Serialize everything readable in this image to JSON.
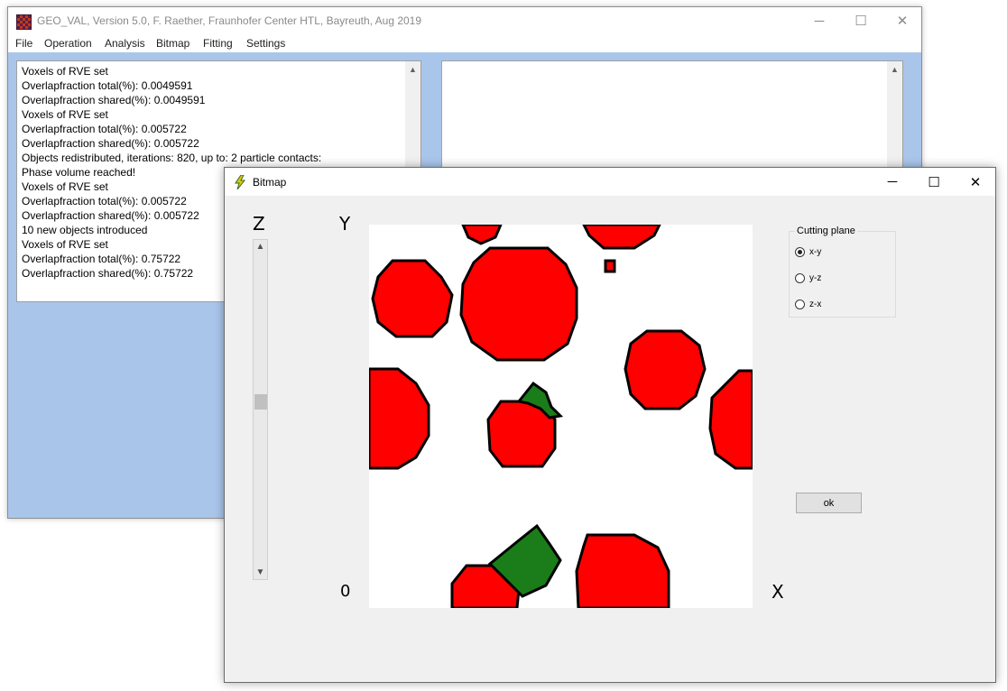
{
  "main_window": {
    "title": "GEO_VAL, Version 5.0, F. Raether, Fraunhofer Center HTL, Bayreuth, Aug 2019",
    "controls": {
      "minimize": "─",
      "maximize": "☐",
      "close": "✕"
    },
    "menu": [
      "File",
      "Operation",
      "Analysis",
      "Bitmap",
      "Fitting",
      "Settings"
    ],
    "log": [
      "Voxels of RVE set",
      "Overlapfraction total(%): 0.0049591",
      "Overlapfraction shared(%): 0.0049591",
      "Voxels of RVE set",
      "Overlapfraction total(%): 0.005722",
      "Overlapfraction shared(%): 0.005722",
      "Objects redistributed, iterations: 820, up to: 2 particle contacts:",
      "Phase volume reached!",
      "Voxels of RVE set",
      "Overlapfraction total(%): 0.005722",
      "Overlapfraction shared(%): 0.005722",
      "10 new objects introduced",
      "Voxels of RVE set",
      "Overlapfraction total(%): 0.75722",
      "Overlapfraction shared(%): 0.75722"
    ],
    "colors": {
      "background": "#a9c6ea"
    }
  },
  "bitmap_dialog": {
    "title": "Bitmap",
    "icon": "lightning-icon",
    "controls": {
      "minimize": "─",
      "maximize": "☐",
      "close": "✕"
    },
    "axis_labels": {
      "z": "Z",
      "y": "Y",
      "origin": "0",
      "x": "X"
    },
    "z_scroll_position": 0.47,
    "cutting_plane": {
      "legend": "Cutting plane",
      "options": [
        {
          "label": "x-y",
          "selected": true
        },
        {
          "label": "y-z",
          "selected": false
        },
        {
          "label": "z-x",
          "selected": false
        }
      ]
    },
    "ok_label": "ok",
    "colors": {
      "particle": "#ff0000",
      "particle_secondary": "#1a7d1a",
      "outline": "#000000"
    }
  }
}
